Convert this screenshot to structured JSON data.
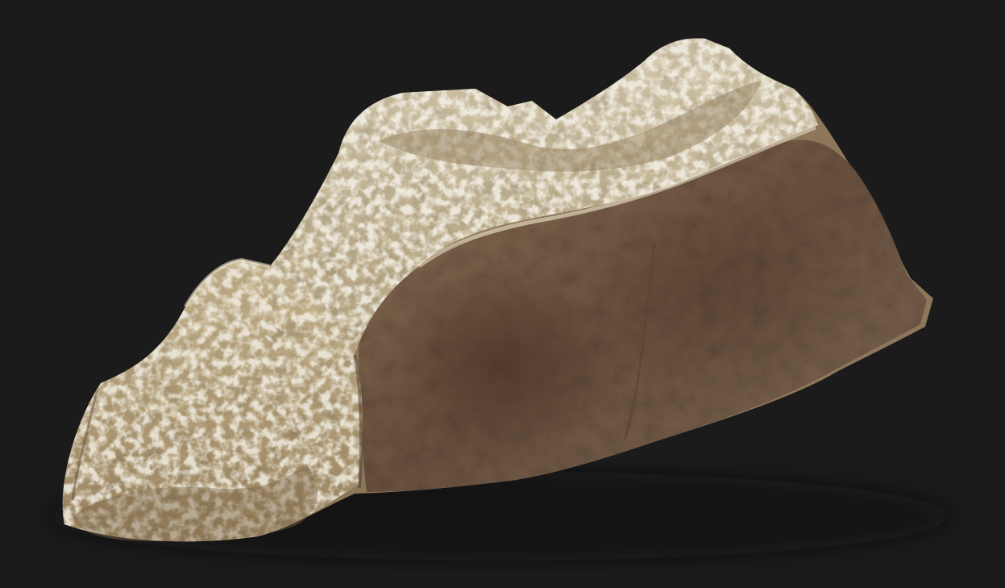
{
  "scene": {
    "subject": "rock-3d-model",
    "colors": {
      "background": "#1b1b1b",
      "stone_light": "#d4c7a8",
      "stone_mid": "#b09a74",
      "stone_dark": "#7a634a",
      "stone_brown": "#6e5442",
      "lichen": "#e2dcc6",
      "shadow": "#3b2e24"
    }
  }
}
